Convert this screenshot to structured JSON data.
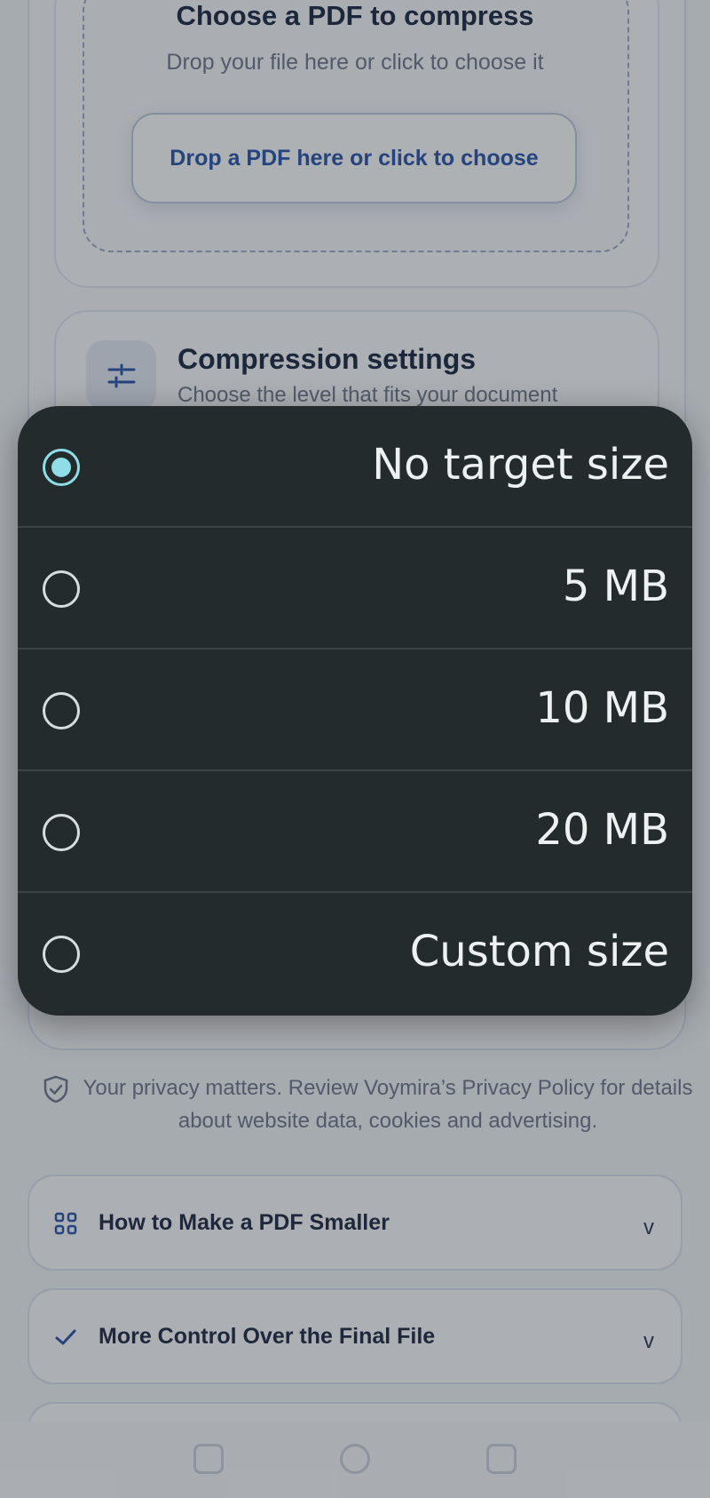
{
  "upload": {
    "title": "Choose a PDF to compress",
    "subtitle": "Drop your file here or click to choose it",
    "button_label": "Drop a PDF here or click to choose"
  },
  "settings": {
    "title": "Compression settings",
    "subtitle": "Choose the level that fits your document",
    "icon": "sliders-icon"
  },
  "privacy": {
    "text": "Your privacy matters. Review Voymira’s Privacy Policy for details about website data, cookies and advertising.",
    "icon": "shield-check-icon"
  },
  "accordions": [
    {
      "label": "How to Make a PDF Smaller",
      "icon": "grid-icon",
      "chevron": "v"
    },
    {
      "label": "More Control Over the Final File",
      "icon": "check-icon",
      "chevron": "v"
    }
  ],
  "dialog": {
    "options": [
      {
        "label": "No target size",
        "selected": true
      },
      {
        "label": "5 MB",
        "selected": false
      },
      {
        "label": "10 MB",
        "selected": false
      },
      {
        "label": "20 MB",
        "selected": false
      },
      {
        "label": "Custom size",
        "selected": false
      }
    ]
  },
  "colors": {
    "accent": "#2450a8",
    "radio_selected": "#8fdde6",
    "dialog_bg": "#242b2d"
  }
}
